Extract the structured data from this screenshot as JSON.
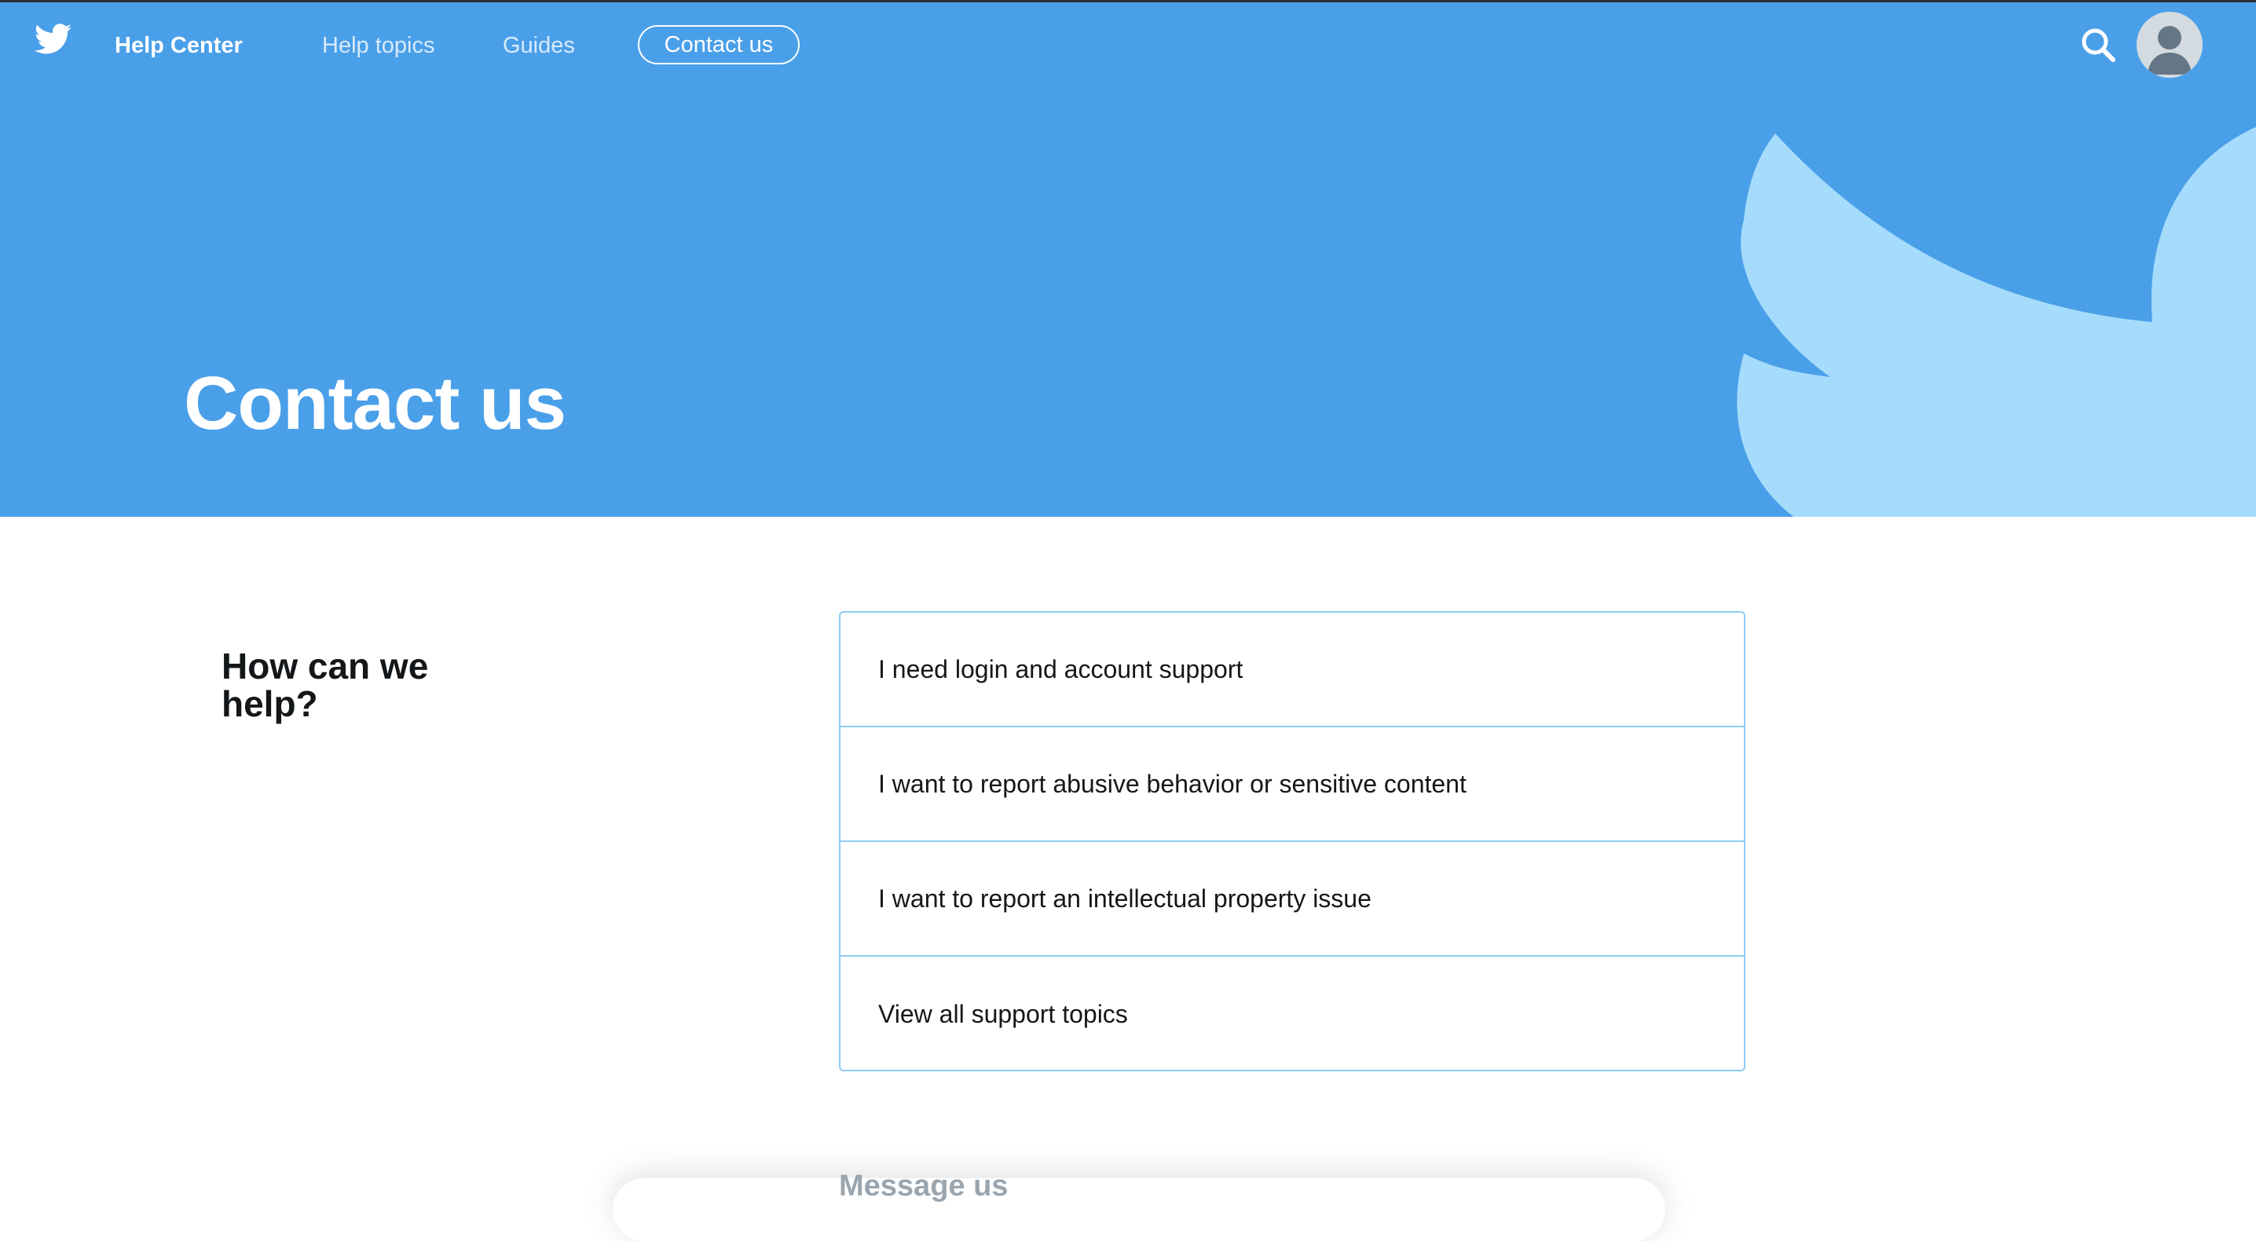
{
  "nav": {
    "brand": "Help Center",
    "links": [
      {
        "label": "Help topics"
      },
      {
        "label": "Guides"
      },
      {
        "label": "Contact us"
      }
    ]
  },
  "hero": {
    "title": "Contact us"
  },
  "main": {
    "heading": "How can we help?",
    "options": [
      {
        "label": "I need login and account support"
      },
      {
        "label": "I want to report abusive behavior or sensitive content"
      },
      {
        "label": "I want to report an intellectual property issue"
      },
      {
        "label": "View all support topics"
      }
    ],
    "message_heading": "Message us"
  },
  "icons": {
    "logo": "twitter-bird-icon",
    "search": "search-icon",
    "avatar": "default-avatar"
  },
  "colors": {
    "hero_background": "#4a9fe9",
    "hero_bird": "#a5dcfb",
    "option_border": "#8ecdf2",
    "text": "#14171a",
    "muted": "#9aa5ae"
  }
}
